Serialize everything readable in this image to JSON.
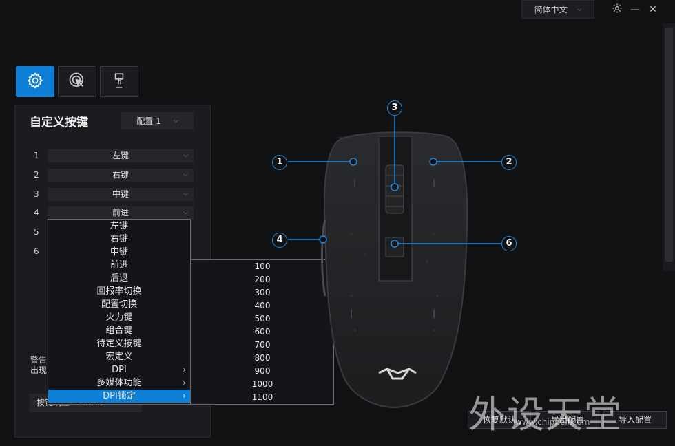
{
  "top_bar": {
    "language": "简体中文",
    "icons": [
      "gear-icon",
      "minimize-icon",
      "close-icon"
    ]
  },
  "mode_tabs": [
    {
      "icon": "gear-icon",
      "active": true
    },
    {
      "icon": "cursor-click-icon",
      "active": false
    },
    {
      "icon": "macro-hand-icon",
      "active": false
    }
  ],
  "panel": {
    "title": "自定义按键",
    "profile": "配置 1",
    "rows": [
      {
        "num": "1",
        "value": "左键"
      },
      {
        "num": "2",
        "value": "右键"
      },
      {
        "num": "3",
        "value": "中键"
      },
      {
        "num": "4",
        "value": "前进"
      },
      {
        "num": "5",
        "value": ""
      },
      {
        "num": "6",
        "value": ""
      }
    ],
    "warning_line1": "警告",
    "warning_line2": "出现",
    "delay_label": "按键响应",
    "delay_value": "12 ms"
  },
  "dropdown": {
    "items": [
      {
        "label": "左键",
        "submenu": false
      },
      {
        "label": "右键",
        "submenu": false
      },
      {
        "label": "中键",
        "submenu": false
      },
      {
        "label": "前进",
        "submenu": false
      },
      {
        "label": "后退",
        "submenu": false
      },
      {
        "label": "回报率切换",
        "submenu": false
      },
      {
        "label": "配置切换",
        "submenu": false
      },
      {
        "label": "火力键",
        "submenu": false
      },
      {
        "label": "组合键",
        "submenu": false
      },
      {
        "label": "待定义按键",
        "submenu": false
      },
      {
        "label": "宏定义",
        "submenu": false
      },
      {
        "label": "DPI",
        "submenu": true
      },
      {
        "label": "多媒体功能",
        "submenu": true
      },
      {
        "label": "DPI锁定",
        "submenu": true,
        "selected": true
      }
    ]
  },
  "submenu": {
    "items": [
      "100",
      "200",
      "300",
      "400",
      "500",
      "600",
      "700",
      "800",
      "900",
      "1000",
      "1100"
    ]
  },
  "mouse": {
    "callouts": [
      "1",
      "2",
      "3",
      "4",
      "6"
    ],
    "brand_logo": "HX"
  },
  "bottom_buttons": {
    "restore": "恢复默认",
    "export": "导出配置",
    "import": "导入配置"
  },
  "watermark": {
    "text": "外设天堂",
    "url": "www.chiphell.com"
  },
  "colors": {
    "accent": "#0d7fd6",
    "background": "#111214",
    "panel": "#1b1c1f"
  }
}
